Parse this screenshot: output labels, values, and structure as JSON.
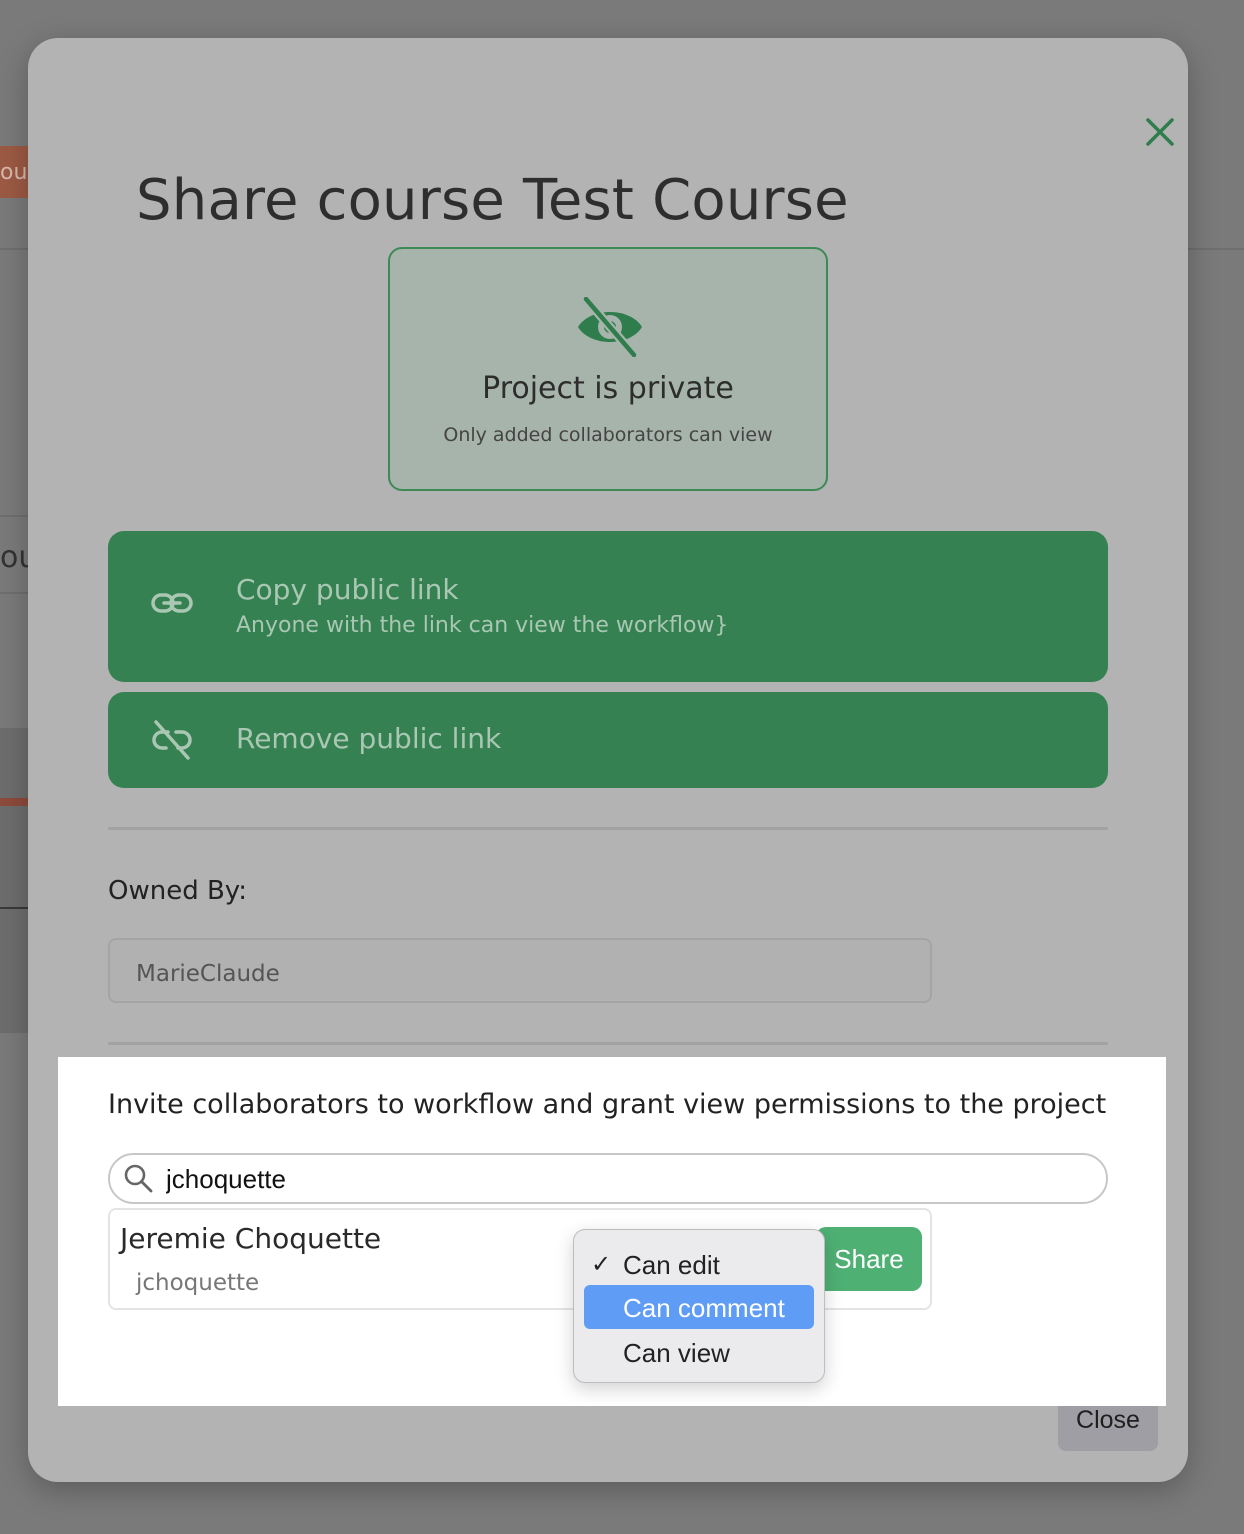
{
  "background": {
    "fragment_1": "our",
    "fragment_2": "ou"
  },
  "modal": {
    "title": "Share course Test Course",
    "close_icon": "close-icon",
    "privacy": {
      "icon": "eye-slash-icon",
      "title": "Project is private",
      "subtitle": "Only added collaborators can view"
    },
    "copy_link": {
      "icon": "link-icon",
      "label": "Copy public link",
      "sublabel": "Anyone with the link can view the workflow}"
    },
    "remove_link": {
      "icon": "link-slash-icon",
      "label": "Remove public link"
    },
    "owned_by": {
      "label": "Owned By:",
      "value": "MarieClaude"
    },
    "invite": {
      "heading": "Invite collaborators to workflow and grant view permissions to the project",
      "search_value": "jchoquette",
      "search_icon": "search-icon",
      "result": {
        "name": "Jeremie Choquette",
        "username": "jchoquette",
        "share_label": "Share"
      }
    },
    "permission_menu": {
      "options": [
        {
          "label": "Can edit",
          "checked": true,
          "check_mark": "✓"
        },
        {
          "label": "Can comment",
          "highlighted": true
        },
        {
          "label": "Can view"
        }
      ]
    },
    "close_label": "Close"
  },
  "colors": {
    "accent_green": "#358152",
    "share_green": "#4fb074",
    "menu_highlight": "#5e9cf5"
  }
}
